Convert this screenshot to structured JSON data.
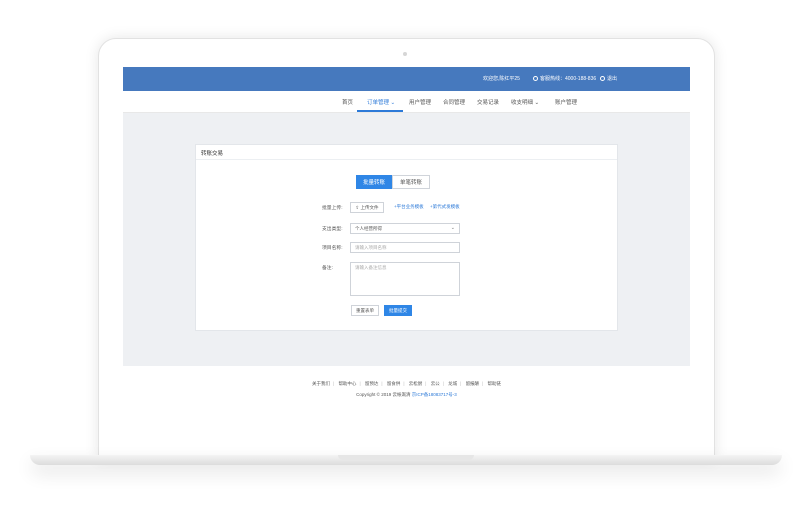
{
  "topbar": {
    "welcome": "欢迎您,陈红平25",
    "hotline": "客服热线：4000-188-836",
    "logout": "退出",
    "bg_color": "#4679be"
  },
  "nav": {
    "items": [
      "首页",
      "订单管理",
      "用户管理",
      "合同管理",
      "交易记录",
      "收支明细",
      "账户管理"
    ],
    "active_index": 1,
    "active_color": "#2d7ad8"
  },
  "card": {
    "title": "转账交易",
    "tabs": {
      "batch": "批量转账",
      "single": "单笔转账"
    },
    "form": {
      "upload_label": "批量上传:",
      "upload_button": "上传文件",
      "template_link_1": "+平台业务模板",
      "template_link_2": "+第代式发模板",
      "type_label": "支出类型:",
      "type_value": "个人经营所得",
      "name_label": "项目名称:",
      "name_placeholder": "请输入项目名称",
      "remark_label": "备注:",
      "remark_placeholder": "请输入备注信息",
      "reset_button": "重置表单",
      "submit_button": "批量提交"
    },
    "accent_color": "#2f86e6"
  },
  "footer": {
    "links": [
      "关于我们",
      "帮助中心",
      "留预达",
      "留食供",
      "云松厨",
      "云公",
      "龙城",
      "留报酬",
      "帮助链"
    ],
    "copyright": "Copyright © 2019 云帐溉清",
    "icp": "京ICP备18083717号-3"
  }
}
